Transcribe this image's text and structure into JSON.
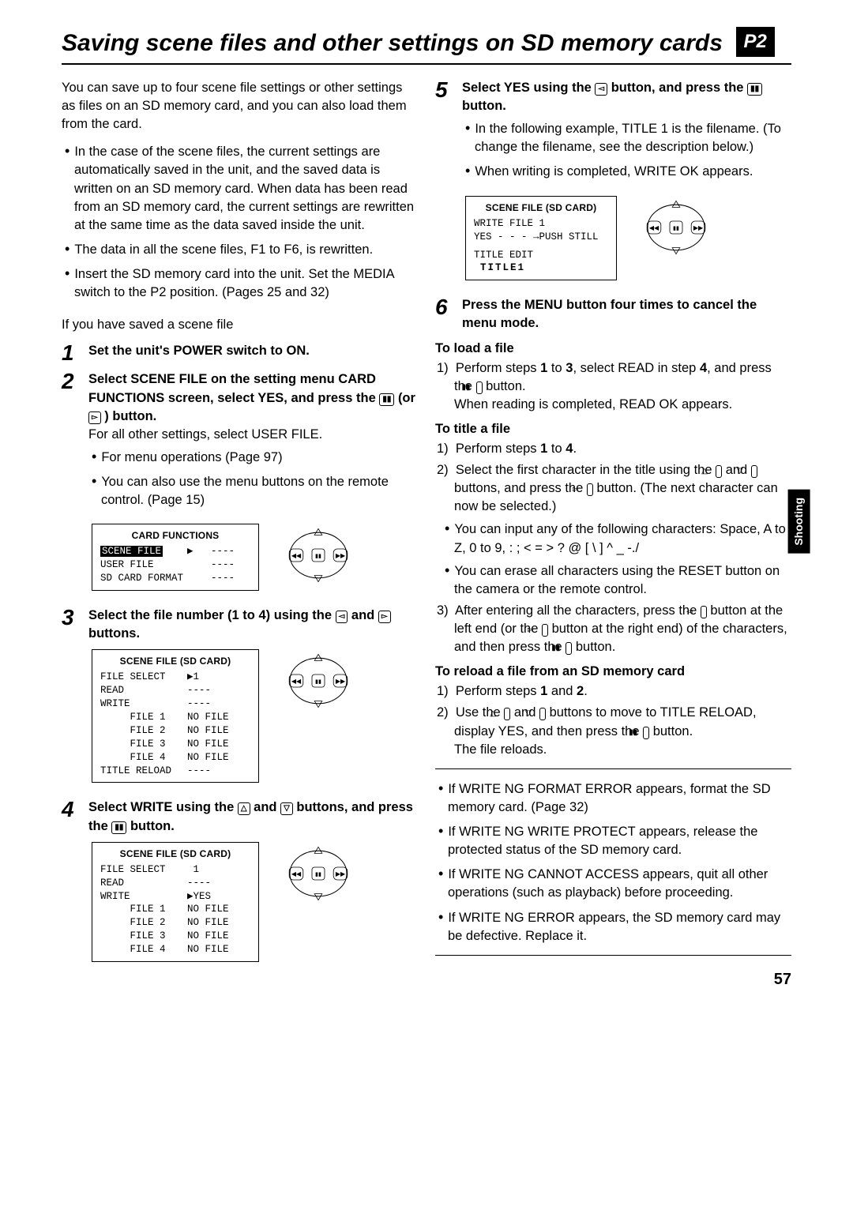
{
  "header": {
    "title": "Saving scene files and other settings on SD memory cards",
    "badge": "P2"
  },
  "side_tab": "Shooting",
  "page_number": "57",
  "left": {
    "intro": "You can save up to four scene file settings or other settings as files on an SD memory card, and you can also load them from the card.",
    "bullets": [
      "In the case of the scene files, the current settings are automatically saved in the unit, and the saved data is written on an SD memory card. When data has been read from an SD memory card, the current settings are rewritten at the same time as the data saved inside the unit.",
      "The data in all the scene files, F1 to F6, is rewritten.",
      "Insert the SD memory card into the unit. Set the MEDIA switch to the P2 position. (Pages 25 and 32)"
    ],
    "pre_if": "If you have saved a scene file",
    "step1": "Set the unit's POWER switch to ON.",
    "step2_head_a": "Select SCENE FILE on the setting menu CARD FUNCTIONS screen, select YES, and press the ",
    "step2_head_b": " (or ",
    "step2_head_c": " ) button.",
    "step2_body1": "For all other settings, select USER FILE.",
    "step2_b": [
      "For menu operations (Page 97)",
      "You can also use the menu buttons on the remote control. (Page 15)"
    ],
    "card_functions": {
      "title": "CARD FUNCTIONS",
      "items": [
        {
          "label": "SCENE FILE",
          "val": "----",
          "sel": true
        },
        {
          "label": "USER FILE",
          "val": "----"
        },
        {
          "label": "SD CARD FORMAT",
          "val": "----"
        }
      ],
      "arrow": "▶"
    },
    "step3_a": "Select the file number (1 to 4) using the ",
    "step3_b": " and ",
    "step3_c": " buttons.",
    "scene_screen3": {
      "title": "SCENE FILE (SD CARD)",
      "rows": [
        {
          "l": "FILE SELECT",
          "v": "▶1"
        },
        {
          "l": "READ",
          "v": "----"
        },
        {
          "l": "WRITE",
          "v": "----"
        },
        {
          "l": "     FILE 1",
          "v": "NO FILE"
        },
        {
          "l": "     FILE 2",
          "v": "NO FILE"
        },
        {
          "l": "     FILE 3",
          "v": "NO FILE"
        },
        {
          "l": "     FILE 4",
          "v": "NO FILE"
        },
        {
          "l": "TITLE RELOAD",
          "v": "----"
        }
      ]
    },
    "step4_a": "Select WRITE using the ",
    "step4_b": " and ",
    "step4_c": " buttons, and press the ",
    "step4_d": " button.",
    "scene_screen4": {
      "title": "SCENE FILE (SD CARD)",
      "rows": [
        {
          "l": "FILE SELECT",
          "v": " 1"
        },
        {
          "l": "READ",
          "v": "----"
        },
        {
          "l": "WRITE",
          "v": "▶YES"
        },
        {
          "l": "     FILE 1",
          "v": "NO FILE"
        },
        {
          "l": "     FILE 2",
          "v": "NO FILE"
        },
        {
          "l": "     FILE 3",
          "v": "NO FILE"
        },
        {
          "l": "     FILE 4",
          "v": "NO FILE"
        }
      ]
    }
  },
  "right": {
    "step5_a": "Select YES using the ",
    "step5_b": " button, and press the ",
    "step5_c": " button.",
    "step5_bullets": [
      "In the following example, TITLE 1 is the filename. (To change the filename, see the description below.)",
      "When writing is completed, WRITE OK appears."
    ],
    "scene_screen5": {
      "title": "SCENE FILE (SD CARD)",
      "line1": "WRITE FILE  1",
      "line2": " YES - - - →PUSH STILL",
      "line3": "TITLE EDIT",
      "line4": "TITLE1"
    },
    "step6": "Press the MENU button four times to cancel the menu mode.",
    "load_head": "To load a file",
    "load_1a": "Perform steps ",
    "load_1b": " to ",
    "load_1c": ", select READ in step ",
    "load_1d": ", and press the ",
    "load_1e": " button.",
    "load_b1": "1",
    "load_b3": "3",
    "load_b4": "4",
    "load_tail": "When reading is completed, READ OK appears.",
    "title_head": "To title a file",
    "title_1a": "Perform steps ",
    "title_1b1": "1",
    "title_1c": " to ",
    "title_1b4": "4",
    "title_1d": ".",
    "title_2a": "Select the first character in the title using the ",
    "title_2b": " and ",
    "title_2c": " buttons, and press the ",
    "title_2d": " button. (The next character can now be selected.)",
    "title_bul": [
      "You can input any of the following characters: Space, A to Z, 0 to 9, : ; < = > ? @ [ \\ ] ^ _ -./",
      "You can erase all characters using the RESET button on the camera or the remote control."
    ],
    "title_3a": "After entering all the characters, press the ",
    "title_3b": " button at the left end (or the ",
    "title_3c": " button at the right end) of the characters, and then press the ",
    "title_3d": " button.",
    "reload_head": "To reload a file from an SD memory card",
    "reload_1a": "Perform steps ",
    "reload_1b1": "1",
    "reload_1b": " and ",
    "reload_1b2": "2",
    "reload_1c": ".",
    "reload_2a": "Use the ",
    "reload_2b": " and ",
    "reload_2c": " buttons to move to TITLE RELOAD, display YES, and then press the ",
    "reload_2d": " button.",
    "reload_tail": "The file reloads.",
    "errors": [
      "If WRITE NG FORMAT ERROR appears, format the SD memory card. (Page 32)",
      "If WRITE NG WRITE PROTECT appears, release the protected status of the SD memory card.",
      "If WRITE NG CANNOT ACCESS appears, quit all other operations (such as playback) before proceeding.",
      "If WRITE NG ERROR appears, the SD memory card may be defective. Replace it."
    ]
  },
  "icons": {
    "pause": "▮▮",
    "fwd": "▻",
    "rew": "◅",
    "up": "△",
    "down": "▽"
  }
}
